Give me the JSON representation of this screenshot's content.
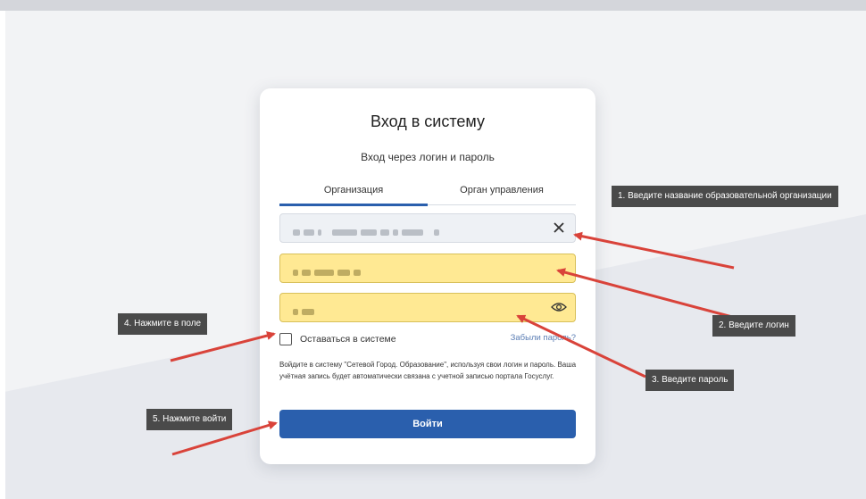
{
  "login": {
    "title": "Вход в систему",
    "subtitle": "Вход через логин и пароль",
    "tabs": [
      {
        "label": "Организация",
        "active": true
      },
      {
        "label": "Орган управления",
        "active": false
      }
    ],
    "organization_field": {
      "value_blurred": true,
      "clear_icon": "close-icon"
    },
    "login_field": {
      "value_blurred": true
    },
    "password_field": {
      "value_blurred": true,
      "toggle_icon": "eye-icon"
    },
    "remember_label": "Оставаться в системе",
    "forgot_label": "Забыли пароль?",
    "info_text": "Войдите в систему \"Сетевой Город. Образование\", используя свои логин и пароль. Ваша учётная запись будет автоматически связана с учетной записью портала Госуслуг.",
    "submit_label": "Войти"
  },
  "callouts": {
    "c1": "1. Введите название образовательной организации",
    "c2": "2. Введите логин",
    "c3": "3. Введите пароль",
    "c4": "4. Нажмите в поле",
    "c5": "5. Нажмите войти"
  },
  "colors": {
    "accent": "#2a5fad",
    "highlight": "#ffe993",
    "arrow": "#d9433a",
    "callout_bg": "#4a4a4a"
  }
}
